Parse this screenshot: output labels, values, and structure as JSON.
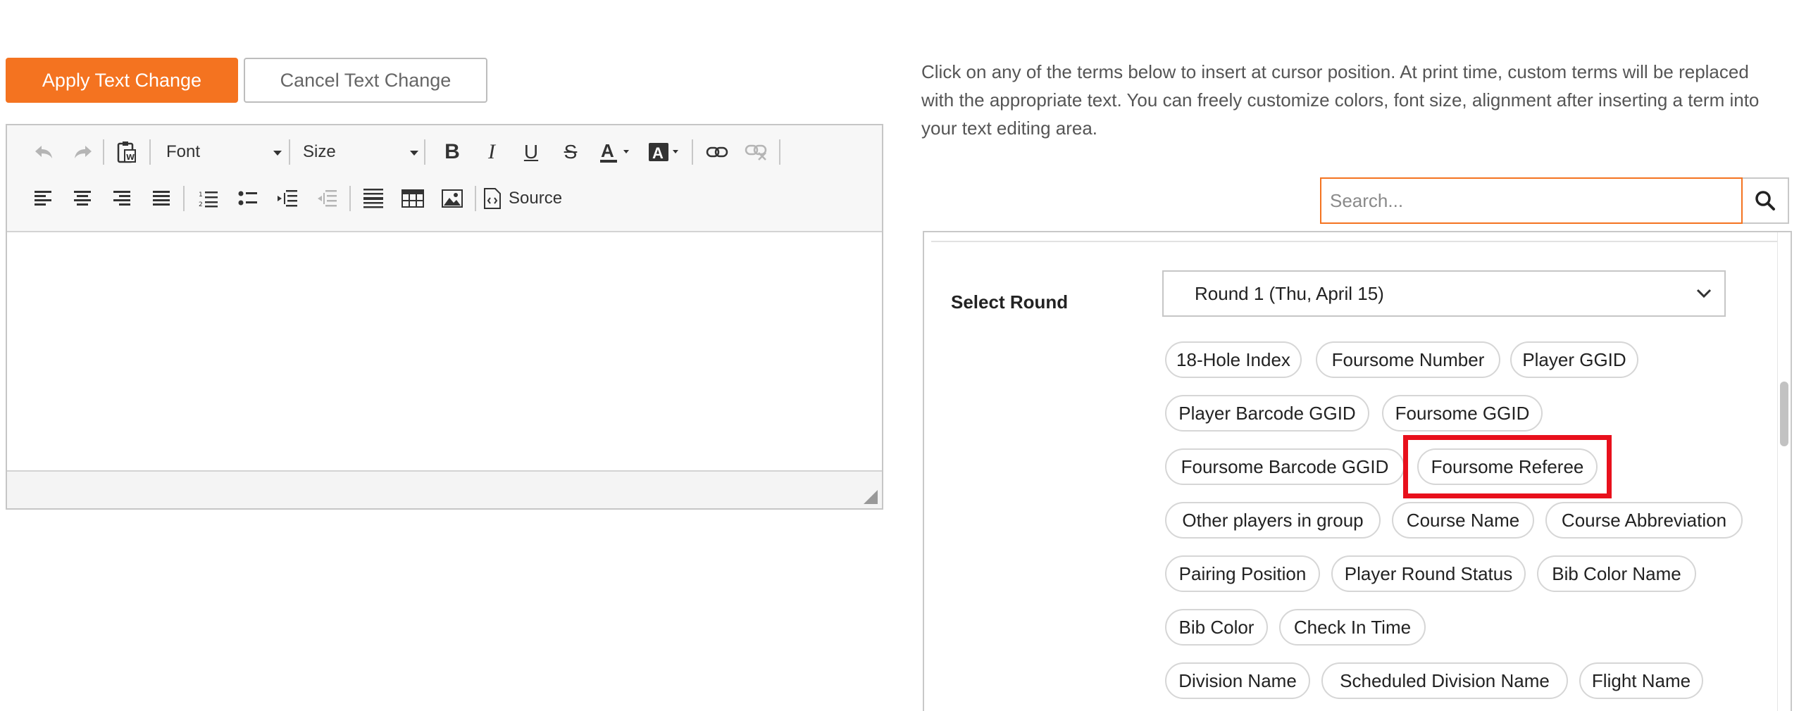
{
  "actions": {
    "apply_label": "Apply Text Change",
    "cancel_label": "Cancel Text Change"
  },
  "editor": {
    "font_label": "Font",
    "size_label": "Size",
    "source_label": "Source"
  },
  "instructions": "Click on any of the terms below to insert at cursor position. At print time, custom terms will be replaced with the appropriate text. You can freely customize colors, font size, alignment after inserting a term into your text editing area.",
  "search": {
    "placeholder": "Search..."
  },
  "round": {
    "label": "Select Round",
    "selected": "Round 1 (Thu, April 15)"
  },
  "terms": [
    "18-Hole Index",
    "Foursome Number",
    "Player GGID",
    "Player Barcode GGID",
    "Foursome GGID",
    "Foursome Barcode GGID",
    "Foursome Referee",
    "Other players in group",
    "Course Name",
    "Course Abbreviation",
    "Pairing Position",
    "Player Round Status",
    "Bib Color Name",
    "Bib Color",
    "Check In Time",
    "Division Name",
    "Scheduled Division Name",
    "Flight Name"
  ],
  "colors": {
    "accent": "#f47320",
    "highlight": "#e8101c"
  }
}
